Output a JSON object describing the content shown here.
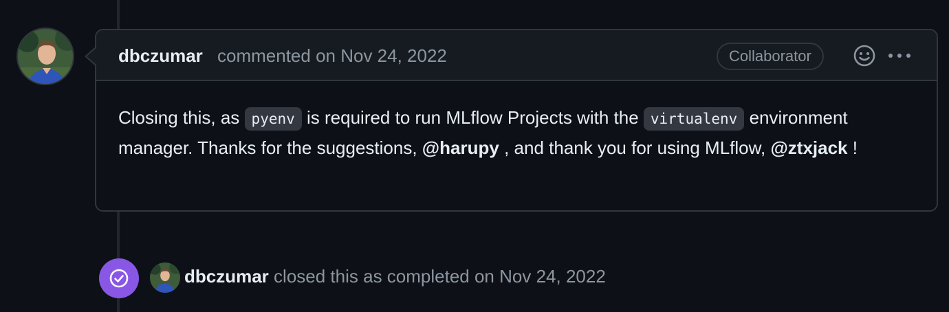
{
  "comment": {
    "author": "dbczumar",
    "action_text": "commented on",
    "date": "Nov 24, 2022",
    "badge": "Collaborator",
    "body": {
      "p1": "Closing this, as",
      "code1": "pyenv",
      "p2": "is required to run MLflow Projects with the",
      "code2": "virtualenv",
      "p3": "environment manager. Thanks for the suggestions,",
      "mention1": "@harupy",
      "p4": ", and thank you for using MLflow,",
      "mention2": "@ztxjack",
      "p5": "!"
    }
  },
  "event": {
    "author": "dbczumar",
    "text": "closed this as completed on",
    "date": "Nov 24, 2022"
  },
  "icons": {
    "emoji": "smiley-icon",
    "more": "kebab-horizontal-icon",
    "closed": "check-circle-icon"
  },
  "colors": {
    "background": "#0d1117",
    "border": "#30363d",
    "header": "#161b22",
    "muted": "#8d96a0",
    "closed_purple": "#8957e5"
  }
}
